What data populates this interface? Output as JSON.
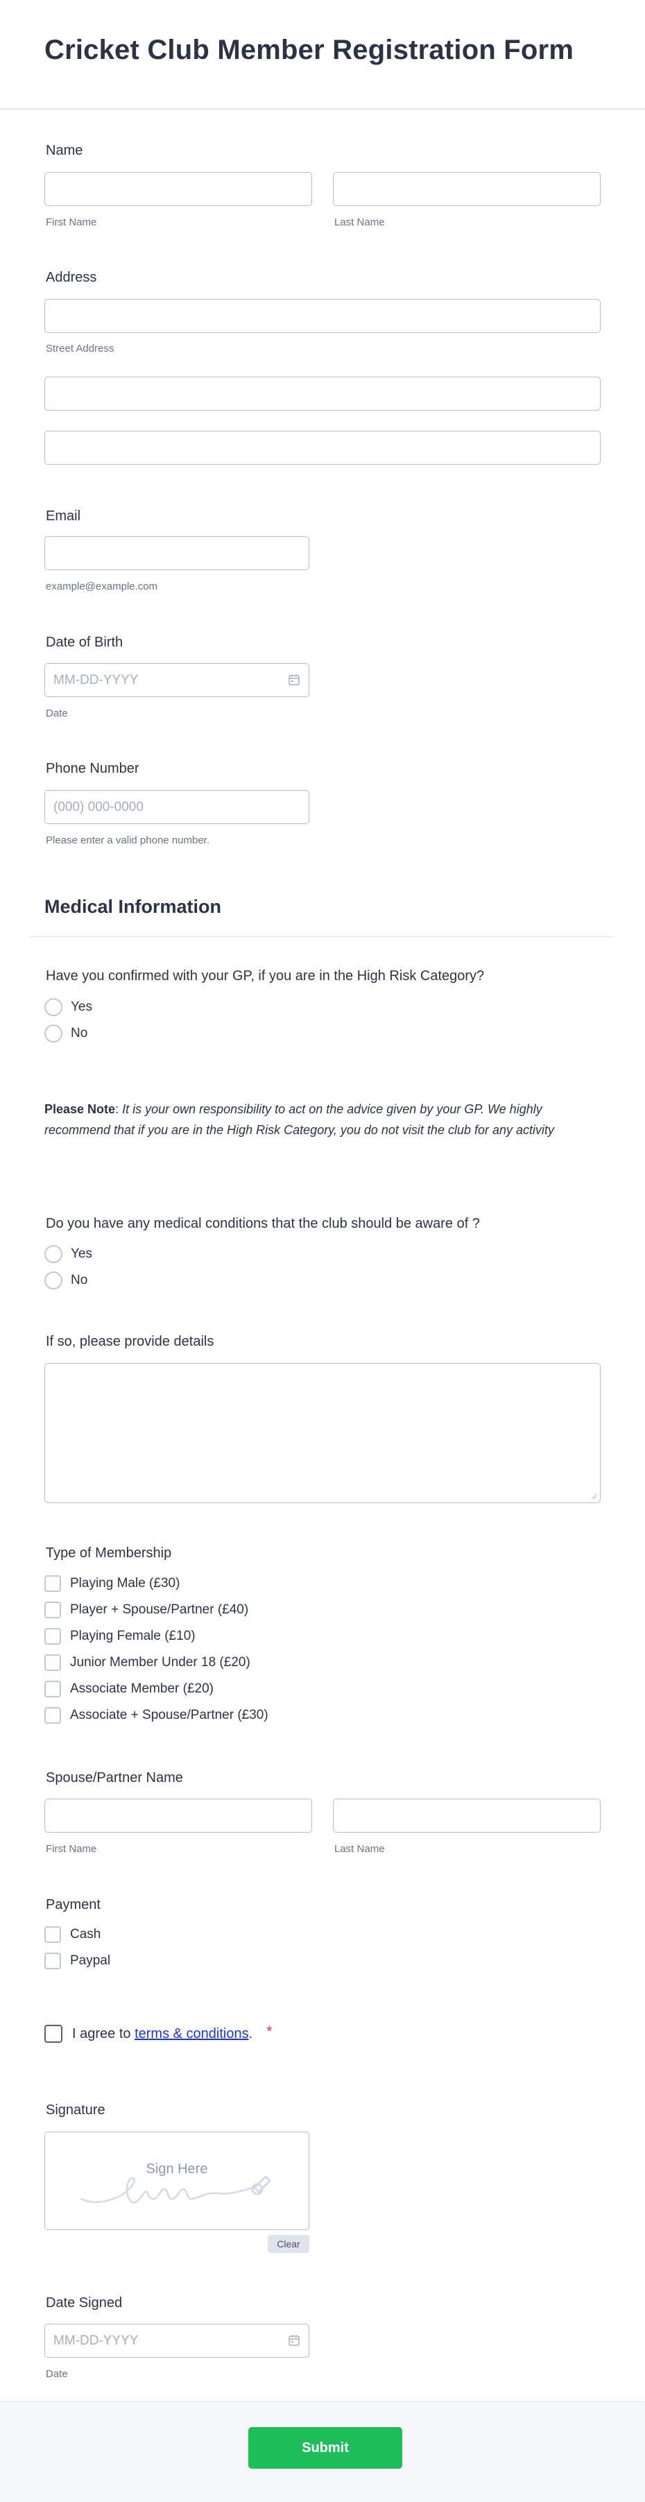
{
  "form": {
    "title": "Cricket Club Member Registration Form",
    "submit_label": "Submit",
    "accent_color": "#1fbc5c",
    "required_color": "#f23a3c",
    "link_color": "#1b35d6"
  },
  "name": {
    "label": "Name",
    "first_sublabel": "First Name",
    "last_sublabel": "Last Name",
    "first_value": "",
    "last_value": ""
  },
  "address": {
    "label": "Address",
    "street_sublabel": "Street Address",
    "line1_value": "",
    "line2_value": "",
    "line3_value": ""
  },
  "email": {
    "label": "Email",
    "sublabel": "example@example.com",
    "value": ""
  },
  "dob": {
    "label": "Date of Birth",
    "placeholder": "MM-DD-YYYY",
    "sublabel": "Date",
    "icon": "calendar-icon"
  },
  "phone": {
    "label": "Phone Number",
    "placeholder": "(000) 000-0000",
    "sublabel": "Please enter a valid phone number."
  },
  "medical": {
    "section_title": "Medical Information",
    "gp_question": "Have you confirmed with your GP, if you are in the High Risk Category?",
    "gp_options": [
      "Yes",
      "No"
    ],
    "note_bold": "Please Note",
    "note_colon": ":",
    "note_text": "It is your own responsibility to act on the advice given by your GP.  We highly recommend that if you are in the High Risk Category, you do not visit the club for any activity",
    "conditions_question": "Do you have any medical conditions that the club should be aware of ?",
    "conditions_options": [
      "Yes",
      "No"
    ],
    "details_label": "If so, please provide details",
    "details_value": ""
  },
  "membership": {
    "label": "Type of Membership",
    "options": [
      "Playing Male (£30)",
      "Player + Spouse/Partner (£40)",
      "Playing Female (£10)",
      "Junior Member Under 18 (£20)",
      "Associate Member (£20)",
      "Associate + Spouse/Partner (£30)"
    ]
  },
  "spouse": {
    "label": "Spouse/Partner Name",
    "first_sublabel": "First Name",
    "last_sublabel": "Last Name"
  },
  "payment": {
    "label": "Payment",
    "options": [
      "Cash",
      "Paypal"
    ]
  },
  "terms": {
    "prefix": "I agree to ",
    "link_text": "terms & conditions",
    "suffix": ".",
    "required_mark": "*"
  },
  "signature": {
    "label": "Signature",
    "placeholder": "Sign Here",
    "clear_label": "Clear"
  },
  "date_signed": {
    "label": "Date Signed",
    "placeholder": "MM-DD-YYYY",
    "sublabel": "Date",
    "icon": "calendar-icon"
  }
}
